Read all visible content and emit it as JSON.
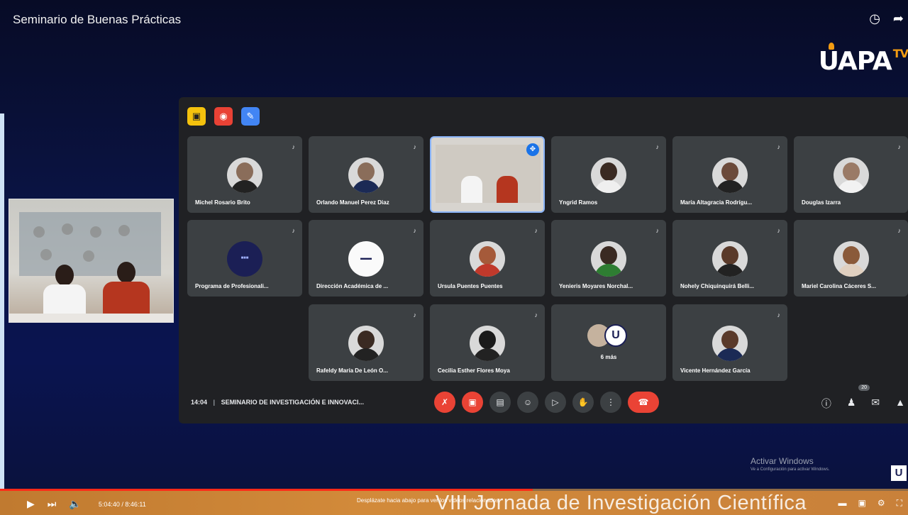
{
  "video_title": "Seminario de Buenas Prácticas",
  "top_icons": [
    "clock-icon",
    "share-icon"
  ],
  "channel_logo": {
    "text": "UAPA",
    "suffix": "TV"
  },
  "meet": {
    "toolbar_icons": [
      "whiteboard-icon",
      "record-icon",
      "notes-icon"
    ],
    "tiles": [
      {
        "name": "Michel Rosario Brito",
        "mic": "♪"
      },
      {
        "name": "Orlando Manuel Perez Diaz",
        "mic": "♪"
      },
      {
        "name": "",
        "mic": "",
        "active": true
      },
      {
        "name": "Yngrid Ramos",
        "mic": "♪"
      },
      {
        "name": "María Altagracia Rodrígu...",
        "mic": "♪"
      },
      {
        "name": "Douglas Izarra",
        "mic": "♪"
      },
      {
        "name": "Programa de Profesionali...",
        "mic": "♪"
      },
      {
        "name": "Dirección Académica de ...",
        "mic": "♪"
      },
      {
        "name": "Ursula Puentes Puentes",
        "mic": "♪"
      },
      {
        "name": "Yenieris Moyares Norchal...",
        "mic": "♪"
      },
      {
        "name": "Nohely Chiquinquirá Belli...",
        "mic": "♪"
      },
      {
        "name": "Mariel Carolina Cáceres S...",
        "mic": "♪"
      },
      {
        "name": "Rafeldy María De León O...",
        "mic": "♪"
      },
      {
        "name": "Cecilia Esther Flores Moya",
        "mic": "♪"
      },
      {
        "name": "6 más",
        "mic": ""
      },
      {
        "name": "Vicente Hernández García",
        "mic": "♪"
      }
    ],
    "meeting_time": "14:04",
    "meeting_name": "SEMINARIO DE INVESTIGACIÓN E INNOVACI...",
    "participant_count": "20",
    "more_badge_letter": "U"
  },
  "windows_watermark": {
    "line1": "Activar Windows",
    "line2": "Ve a Configuración para activar Windows."
  },
  "corner_badge": "U",
  "player": {
    "time": "5:04:40 / 8:46:11",
    "progress": 0.587,
    "notice": "Desplázate hacia abajo para ver los videos relacionados",
    "ticker": "VIII Jornada de Investigación Científica"
  }
}
